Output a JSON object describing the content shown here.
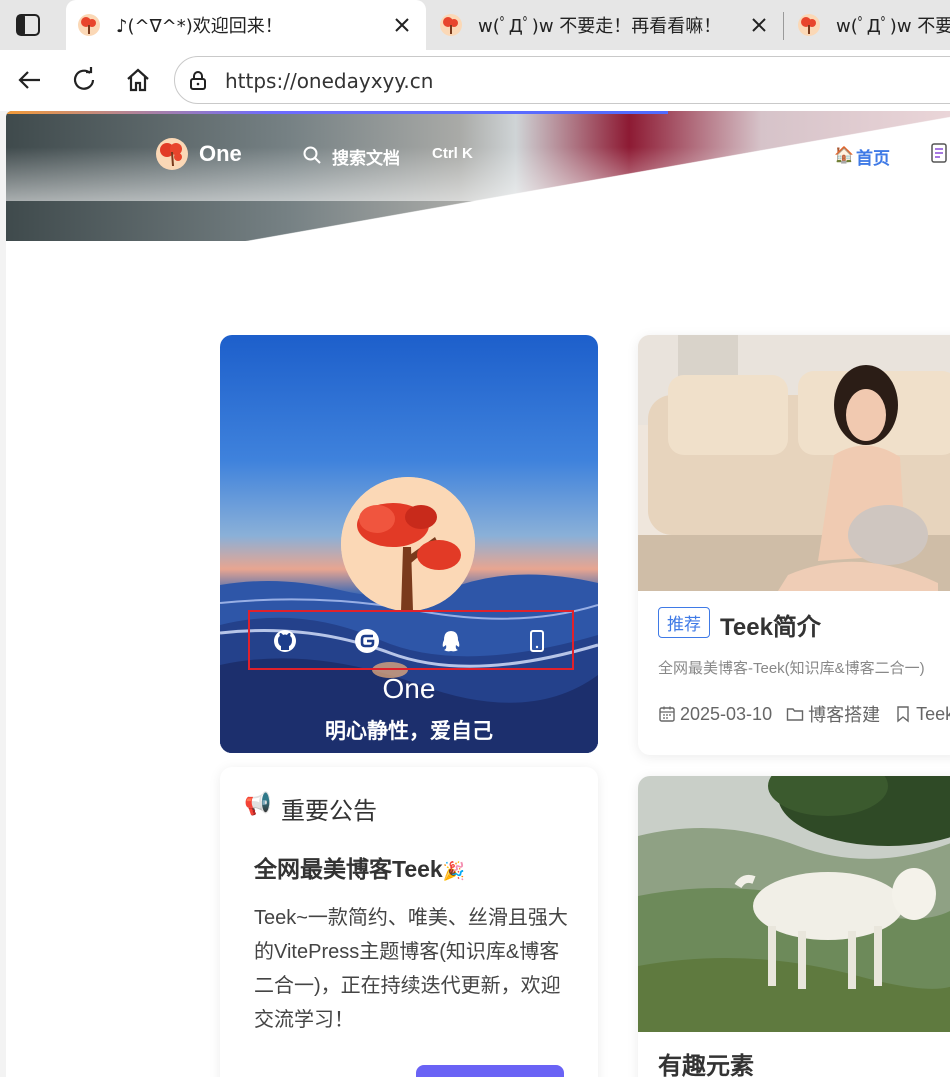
{
  "browser": {
    "tabs": [
      {
        "title": "♪(^∇^*)欢迎回来！",
        "active": true
      },
      {
        "title": "w(ﾟДﾟ)w 不要走！再看看嘛！",
        "active": false
      },
      {
        "title": "w(ﾟДﾟ)w 不要走！再看看嘛！",
        "active": false
      }
    ],
    "url": "https://onedayxyy.cn"
  },
  "site": {
    "name": "One",
    "search_label": "搜索文档",
    "search_shortcut": "Ctrl K",
    "nav_home_icon": "🏠",
    "nav_home": "首页"
  },
  "profile": {
    "name": "One",
    "motto": "明心静性，爱自己",
    "social_icons": [
      "github-icon",
      "gitee-icon",
      "qq-icon",
      "phone-icon"
    ]
  },
  "notice": {
    "icon": "📢",
    "heading": "重要公告",
    "title": "全网最美博客Teek",
    "title_emoji": "🎉",
    "body": "Teek~一款简约、唯美、丝滑且强大的VitePress主题博客(知识库&博客二合一)，正在持续迭代更新，欢迎交流学习！"
  },
  "posts": [
    {
      "tag": "推荐",
      "title": "Teek简介",
      "description": "全网最美博客-Teek(知识库&博客二合一)",
      "date": "2025-03-10",
      "category": "博客搭建",
      "tag_label": "Teek"
    },
    {
      "title": "有趣元素"
    }
  ],
  "colors": {
    "accent": "#3f7ae6",
    "button": "#6a63f5",
    "highlight_box": "#e0212b"
  }
}
